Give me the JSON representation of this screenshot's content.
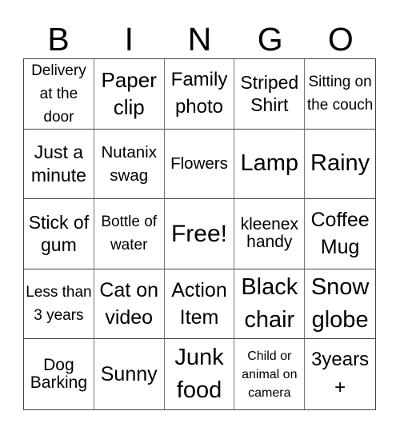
{
  "header": {
    "letters": [
      "B",
      "I",
      "N",
      "G",
      "O"
    ]
  },
  "grid": {
    "rows": [
      [
        "Delivery at the door",
        "Paper clip",
        "Family photo",
        "Striped Shirt",
        "Sitting on the couch"
      ],
      [
        "Just a minute",
        "Nutanix swag",
        "Flowers",
        "Lamp",
        "Rainy"
      ],
      [
        "Stick of gum",
        "Bottle of water",
        "Free!",
        "kleenex handy",
        "Coffee Mug"
      ],
      [
        "Less than 3 years",
        "Cat on video",
        "Action Item",
        "Black chair",
        "Snow globe"
      ],
      [
        "Dog Barking",
        "Sunny",
        "Junk food",
        "Child or animal on camera",
        "3years +"
      ]
    ]
  }
}
